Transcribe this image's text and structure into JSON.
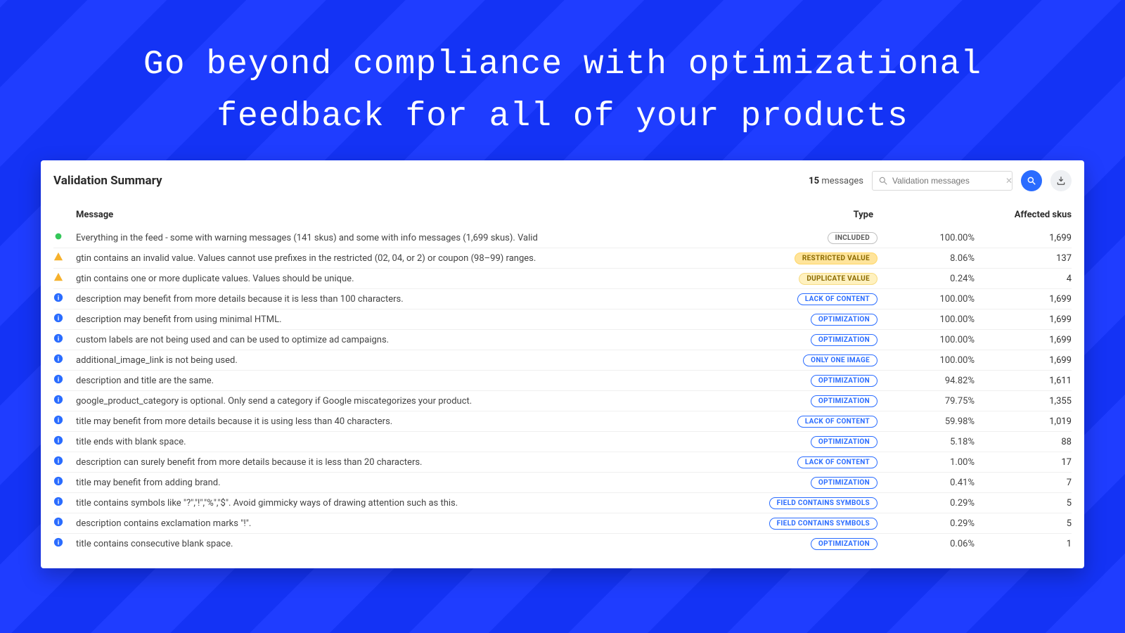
{
  "hero": {
    "line1": "Go beyond compliance with optimizational",
    "line2": "feedback for all of your products"
  },
  "card": {
    "title": "Validation Summary",
    "messages_count": "15",
    "messages_label": "messages",
    "search_placeholder": "Validation messages"
  },
  "columns": {
    "message": "Message",
    "type": "Type",
    "affected": "Affected skus"
  },
  "badge_labels": {
    "included": "INCLUDED",
    "restricted": "RESTRICTED VALUE",
    "duplicate": "DUPLICATE VALUE",
    "lack": "LACK OF CONTENT",
    "opt": "OPTIMIZATION",
    "oneimg": "ONLY ONE IMAGE",
    "symbols": "FIELD CONTAINS SYMBOLS"
  },
  "rows": [
    {
      "icon": "dot",
      "msg": "Everything in the feed - some with warning messages (141 skus) and some with info messages (1,699 skus). Valid",
      "type": "included",
      "pct": "100.00%",
      "skus": "1,699"
    },
    {
      "icon": "warn",
      "msg": "gtin contains an invalid value. Values cannot use prefixes in the restricted (02, 04, or 2) or coupon (98–99) ranges.",
      "type": "restricted",
      "pct": "8.06%",
      "skus": "137"
    },
    {
      "icon": "warn",
      "msg": "gtin contains one or more duplicate values. Values should be unique.",
      "type": "duplicate",
      "pct": "0.24%",
      "skus": "4"
    },
    {
      "icon": "info",
      "msg": "description may benefit from more details because it is less than 100 characters.",
      "type": "lack",
      "pct": "100.00%",
      "skus": "1,699"
    },
    {
      "icon": "info",
      "msg": "description may benefit from using minimal HTML.",
      "type": "opt",
      "pct": "100.00%",
      "skus": "1,699"
    },
    {
      "icon": "info",
      "msg": "custom labels are not being used and can be used to optimize ad campaigns.",
      "type": "opt",
      "pct": "100.00%",
      "skus": "1,699"
    },
    {
      "icon": "info",
      "msg": "additional_image_link is not being used.",
      "type": "oneimg",
      "pct": "100.00%",
      "skus": "1,699"
    },
    {
      "icon": "info",
      "msg": "description and title are the same.",
      "type": "opt",
      "pct": "94.82%",
      "skus": "1,611"
    },
    {
      "icon": "info",
      "msg": "google_product_category is optional. Only send a category if Google miscategorizes your product.",
      "type": "opt",
      "pct": "79.75%",
      "skus": "1,355"
    },
    {
      "icon": "info",
      "msg": "title may benefit from more details because it is using less than 40 characters.",
      "type": "lack",
      "pct": "59.98%",
      "skus": "1,019"
    },
    {
      "icon": "info",
      "msg": "title ends with blank space.",
      "type": "opt",
      "pct": "5.18%",
      "skus": "88"
    },
    {
      "icon": "info",
      "msg": "description can surely benefit from more details because it is less than 20 characters.",
      "type": "lack",
      "pct": "1.00%",
      "skus": "17"
    },
    {
      "icon": "info",
      "msg": "title may benefit from adding brand.",
      "type": "opt",
      "pct": "0.41%",
      "skus": "7"
    },
    {
      "icon": "info",
      "msg": "title contains symbols like \"?\",\"!\",\"%\",\"$\". Avoid gimmicky ways of drawing attention such as this.",
      "type": "symbols",
      "pct": "0.29%",
      "skus": "5"
    },
    {
      "icon": "info",
      "msg": "description contains exclamation marks \"!\".",
      "type": "symbols",
      "pct": "0.29%",
      "skus": "5"
    },
    {
      "icon": "info",
      "msg": "title contains consecutive blank space.",
      "type": "opt",
      "pct": "0.06%",
      "skus": "1"
    }
  ]
}
